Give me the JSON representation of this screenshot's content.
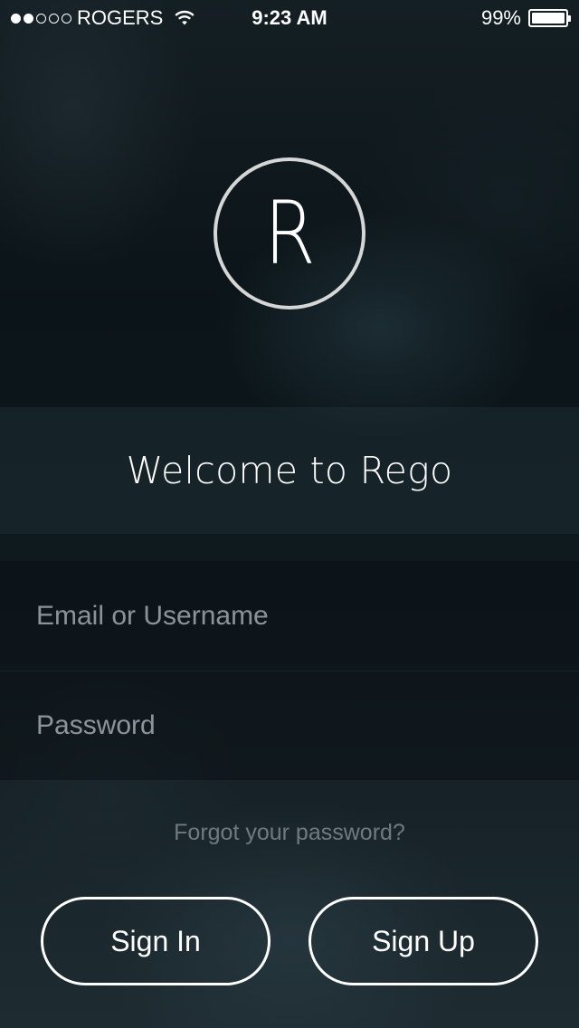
{
  "status_bar": {
    "signal_dots": [
      true,
      true,
      false,
      false,
      false
    ],
    "carrier": "ROGERS",
    "time": "9:23 AM",
    "battery_percent": "99%",
    "battery_level": 0.99
  },
  "logo": {
    "letter": "R"
  },
  "welcome": {
    "title": "Welcome to Rego"
  },
  "form": {
    "username_placeholder": "Email or Username",
    "password_placeholder": "Password"
  },
  "forgot_password": "Forgot your password?",
  "buttons": {
    "sign_in": "Sign In",
    "sign_up": "Sign Up"
  },
  "icons": {
    "wifi": "wifi-icon",
    "battery": "battery-icon",
    "signal": "signal-strength-icon"
  }
}
